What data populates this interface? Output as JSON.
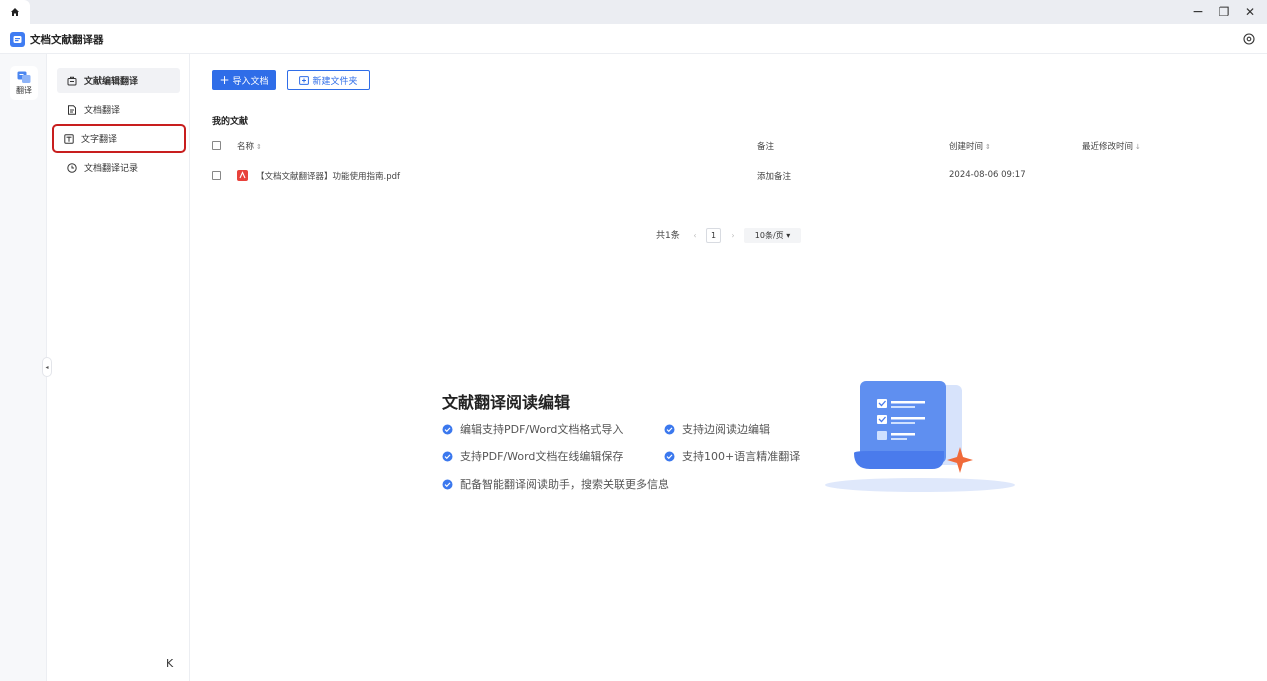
{
  "window": {
    "minimize": "−",
    "restore": "❐",
    "close": "✕"
  },
  "app": {
    "title": "文档文献翻译器"
  },
  "rail": {
    "label": "翻译"
  },
  "nav": {
    "items": [
      {
        "label": "文献编辑翻译",
        "icon": "bag-icon"
      },
      {
        "label": "文档翻译",
        "icon": "doc-icon"
      },
      {
        "label": "文字翻译",
        "icon": "text-icon"
      },
      {
        "label": "文档翻译记录",
        "icon": "clock-icon"
      }
    ],
    "collapse": "K",
    "handle": "◂"
  },
  "toolbar": {
    "import_label": "导入文档",
    "import_plus": "+",
    "newfolder_label": "新建文件夹"
  },
  "list": {
    "title": "我的文献",
    "columns": {
      "name": "名称",
      "note": "备注",
      "created": "创建时间",
      "modified": "最近修改时间"
    },
    "rows": [
      {
        "name": "【文档文献翻译器】功能使用指南.pdf",
        "note": "添加备注",
        "created": "2024-08-06 09:17",
        "modified": ""
      }
    ]
  },
  "pagination": {
    "total": "共1条",
    "prev": "‹",
    "page": "1",
    "next": "›",
    "size": "10条/页 ▾"
  },
  "features": {
    "title": "文献翻译阅读编辑",
    "items": [
      "编辑支持PDF/Word文档格式导入",
      "支持边阅读边编辑",
      "支持PDF/Word文档在线编辑保存",
      "支持100+语言精准翻译",
      "配备智能翻译阅读助手，搜索关联更多信息"
    ]
  },
  "colors": {
    "accent": "#2f6de8",
    "highlight_box": "#c81e1e",
    "pdf": "#e8423b"
  }
}
